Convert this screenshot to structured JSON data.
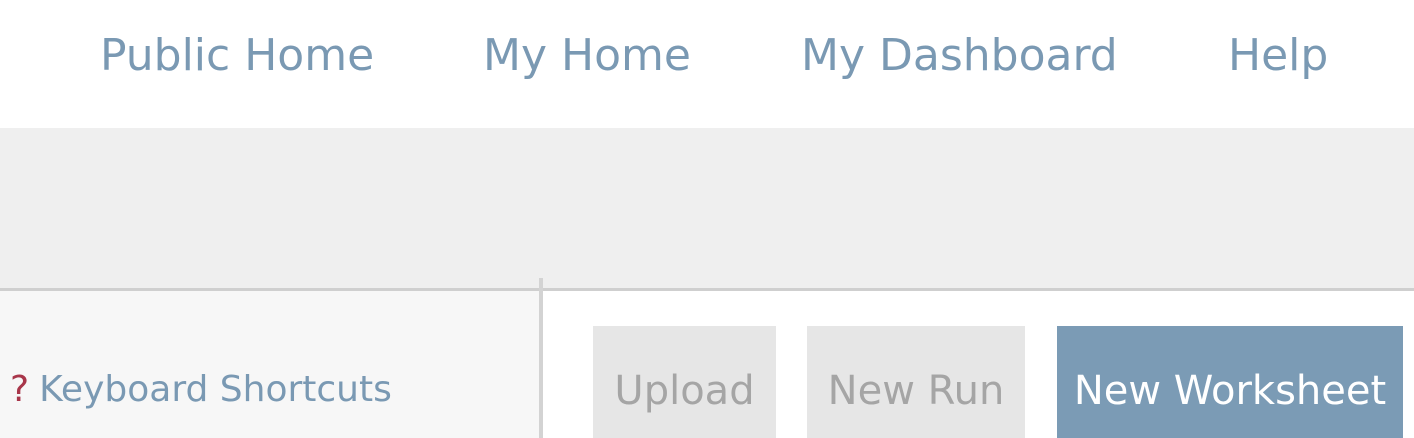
{
  "nav": {
    "items": [
      {
        "label": "Public Home"
      },
      {
        "label": "My Home"
      },
      {
        "label": "My Dashboard"
      },
      {
        "label": "Help"
      }
    ]
  },
  "sidebar": {
    "shortcuts_icon": "?",
    "shortcuts_label": "Keyboard Shortcuts"
  },
  "toolbar": {
    "upload_label": "Upload",
    "new_run_label": "New Run",
    "new_worksheet_label": "New Worksheet"
  },
  "colors": {
    "link": "#7a99b3",
    "accent": "#7b9bb5",
    "help_icon": "#a8364a"
  },
  "icons": {
    "shortcuts": "question-mark-icon"
  }
}
